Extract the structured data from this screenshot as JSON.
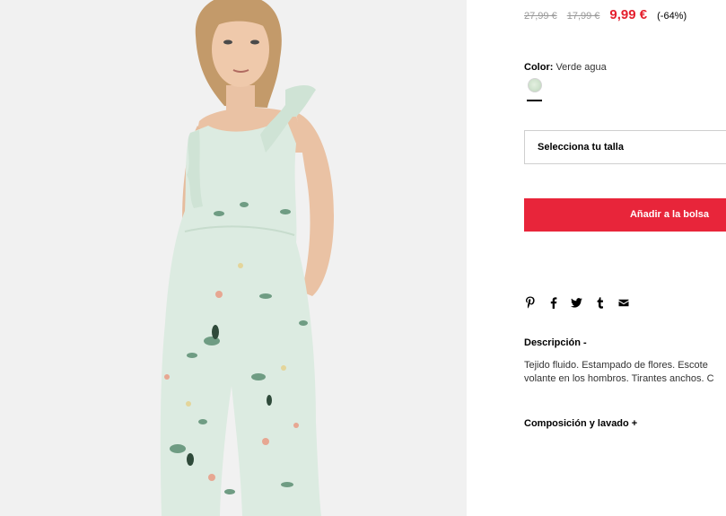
{
  "product": {
    "old_price_1": "27,99 €",
    "old_price_2": "17,99 €",
    "current_price": "9,99 €",
    "discount": "(-64%)",
    "color_label": "Color:",
    "color_value": "Verde agua",
    "size_placeholder": "Selecciona tu talla",
    "add_to_bag": "Añadir a la bolsa",
    "description_title": "Descripción -",
    "description_line_1": "Tejido fluido. Estampado de flores. Escote",
    "description_line_2": "volante en los hombros. Tirantes anchos. C",
    "composition_title": "Composición y lavado +"
  },
  "share_icons": [
    "pinterest-icon",
    "facebook-icon",
    "twitter-icon",
    "tumblr-icon",
    "email-icon"
  ],
  "colors": {
    "price_red": "#e5202e",
    "button_red": "#e8253a",
    "swatch": "#d6e8d3",
    "jumpsuit": "#dcebe1"
  }
}
